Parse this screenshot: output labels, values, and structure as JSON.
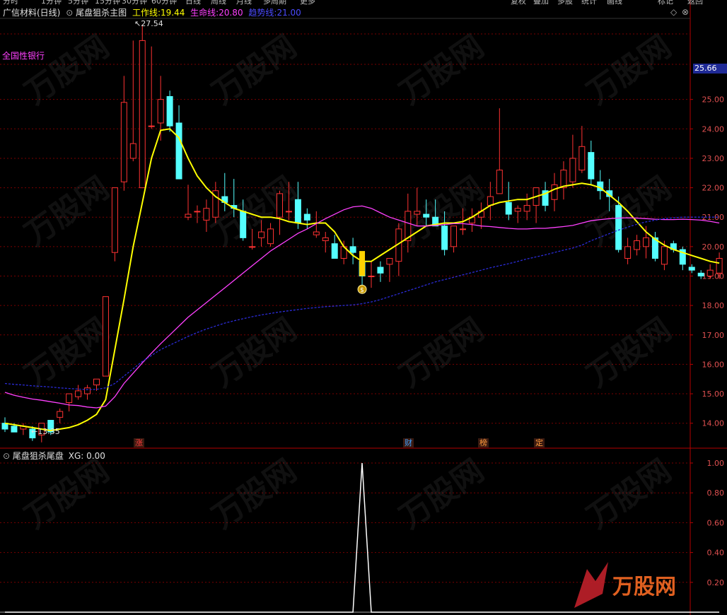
{
  "top_toolbar": [
    "分时",
    "1分钟",
    "5分钟",
    "15分钟",
    "30分钟",
    "60分钟",
    "日线",
    "周线",
    "月线",
    "多周期",
    "更多",
    "复权",
    "叠加",
    "多股",
    "统计",
    "画线",
    "标记",
    "返回"
  ],
  "header": {
    "stock": "广信材料(日线)",
    "indicator": "尾盘狙杀主图",
    "work_label": "工作线:",
    "work_value": "19.44",
    "life_label": "生命线:",
    "life_value": "20.80",
    "trend_label": "趋势线:",
    "trend_value": "21.00"
  },
  "sector_label": "全国性银行",
  "sub_header": {
    "indicator": "尾盘狙杀尾盘",
    "xg_label": "XG:",
    "xg_value": "0.00"
  },
  "annotations": {
    "high": "27.54",
    "low": "13.35",
    "current_price": "25.66"
  },
  "event_tags": [
    {
      "text": "涨",
      "index": 8
    },
    {
      "text": "财",
      "index": 25
    },
    {
      "text": "榜",
      "index": 30
    },
    {
      "text": "定",
      "index": 34
    }
  ],
  "colors": {
    "up": "#ff3232",
    "down": "#54ffff",
    "work": "#ffff00",
    "life": "#ff40ff",
    "trend": "#2b2bd6",
    "grid": "#7a0000",
    "axis": "#b40000",
    "bg": "#000000"
  },
  "chart_data": [
    {
      "type": "candlestick",
      "y_ticks": [
        "25.00",
        "24.00",
        "23.00",
        "22.00",
        "21.00",
        "20.00",
        "19.00",
        "18.00",
        "17.00",
        "16.00",
        "15.00",
        "14.00"
      ],
      "ylim": [
        13.2,
        27.85
      ],
      "ohlc": [
        [
          14.0,
          14.2,
          13.7,
          13.8
        ],
        [
          13.9,
          14.0,
          13.7,
          13.7
        ],
        [
          13.8,
          14.0,
          13.6,
          13.9
        ],
        [
          13.8,
          13.9,
          13.4,
          13.5
        ],
        [
          13.6,
          14.0,
          13.35,
          14.0
        ],
        [
          14.1,
          14.1,
          13.6,
          13.7
        ],
        [
          14.2,
          14.5,
          14.0,
          14.4
        ],
        [
          14.7,
          15.0,
          14.4,
          15.0
        ],
        [
          14.9,
          15.3,
          14.8,
          15.1
        ],
        [
          15.0,
          15.3,
          14.8,
          15.2
        ],
        [
          15.3,
          15.5,
          15.1,
          15.5
        ],
        [
          15.6,
          18.3,
          15.6,
          18.3
        ],
        [
          19.8,
          22.0,
          19.5,
          22.0
        ],
        [
          22.2,
          25.8,
          21.9,
          24.9
        ],
        [
          23.0,
          27.0,
          22.9,
          23.5
        ],
        [
          22.0,
          27.54,
          22.0,
          27.0
        ],
        [
          24.1,
          26.8,
          24.0,
          24.1
        ],
        [
          24.2,
          25.8,
          23.6,
          25.0
        ],
        [
          25.1,
          25.3,
          23.9,
          24.1
        ],
        [
          24.2,
          24.8,
          22.3,
          22.3
        ],
        [
          21.0,
          22.1,
          20.9,
          21.1
        ],
        [
          21.2,
          21.4,
          20.8,
          21.2
        ],
        [
          20.9,
          21.6,
          20.5,
          21.3
        ],
        [
          21.0,
          22.2,
          20.8,
          21.9
        ],
        [
          21.7,
          22.5,
          21.2,
          21.5
        ],
        [
          21.4,
          22.3,
          21.0,
          21.3
        ],
        [
          21.2,
          21.6,
          20.2,
          20.3
        ],
        [
          20.0,
          20.6,
          19.9,
          20.0
        ],
        [
          20.3,
          20.9,
          20.0,
          20.5
        ],
        [
          20.1,
          20.8,
          20.0,
          20.6
        ],
        [
          21.0,
          21.9,
          20.4,
          21.8
        ],
        [
          21.2,
          22.2,
          20.9,
          21.2
        ],
        [
          21.6,
          22.2,
          20.6,
          20.8
        ],
        [
          21.1,
          21.3,
          20.6,
          20.9
        ],
        [
          20.4,
          21.2,
          20.3,
          20.5
        ],
        [
          20.2,
          20.5,
          19.8,
          20.3
        ],
        [
          20.1,
          20.4,
          19.6,
          19.6
        ],
        [
          19.6,
          20.2,
          19.4,
          20.0
        ],
        [
          20.0,
          20.3,
          19.4,
          19.8
        ],
        [
          19.5,
          19.6,
          18.6,
          19.0
        ],
        [
          19.0,
          19.5,
          18.6,
          19.0
        ],
        [
          19.3,
          19.5,
          18.8,
          19.1
        ],
        [
          19.4,
          19.6,
          18.8,
          19.6
        ],
        [
          19.5,
          20.8,
          19.0,
          20.6
        ],
        [
          20.2,
          21.8,
          19.8,
          21.2
        ],
        [
          21.1,
          22.0,
          20.7,
          21.2
        ],
        [
          21.1,
          21.6,
          20.7,
          21.0
        ],
        [
          21.0,
          21.6,
          20.7,
          20.7
        ],
        [
          20.7,
          21.2,
          19.7,
          19.9
        ],
        [
          20.0,
          20.7,
          19.8,
          20.7
        ],
        [
          20.6,
          21.3,
          20.4,
          20.6
        ],
        [
          20.8,
          21.3,
          20.5,
          21.0
        ],
        [
          21.0,
          21.5,
          20.6,
          21.2
        ],
        [
          21.4,
          22.2,
          20.9,
          21.7
        ],
        [
          21.8,
          24.7,
          21.8,
          22.6
        ],
        [
          21.5,
          22.2,
          20.9,
          21.1
        ],
        [
          21.2,
          21.4,
          20.8,
          21.3
        ],
        [
          21.2,
          21.8,
          20.9,
          21.4
        ],
        [
          21.4,
          22.0,
          20.8,
          22.0
        ],
        [
          21.9,
          22.2,
          21.2,
          21.4
        ],
        [
          21.6,
          22.5,
          21.2,
          22.1
        ],
        [
          22.0,
          22.9,
          21.6,
          22.6
        ],
        [
          22.2,
          23.8,
          22.0,
          23.0
        ],
        [
          22.6,
          24.1,
          22.5,
          23.4
        ],
        [
          23.2,
          23.6,
          22.1,
          22.3
        ],
        [
          22.2,
          22.6,
          21.6,
          21.9
        ],
        [
          21.9,
          22.3,
          21.2,
          21.7
        ],
        [
          21.4,
          21.7,
          19.8,
          19.9
        ],
        [
          19.6,
          20.3,
          19.4,
          20.0
        ],
        [
          19.9,
          20.4,
          19.7,
          20.2
        ],
        [
          20.0,
          20.7,
          19.6,
          20.3
        ],
        [
          20.3,
          20.5,
          19.5,
          19.6
        ],
        [
          19.4,
          20.2,
          19.2,
          20.0
        ],
        [
          20.1,
          20.2,
          19.8,
          19.9
        ],
        [
          19.9,
          20.0,
          19.2,
          19.4
        ],
        [
          19.3,
          19.4,
          19.1,
          19.2
        ],
        [
          19.1,
          19.2,
          18.9,
          19.0
        ],
        [
          19.0,
          19.4,
          18.9,
          19.2
        ],
        [
          19.1,
          19.8,
          18.9,
          19.6
        ]
      ],
      "lines": [
        {
          "name": "工作线",
          "color": "#ffff00",
          "values": [
            14.0,
            13.95,
            13.9,
            13.85,
            13.8,
            13.75,
            13.8,
            13.85,
            13.95,
            14.1,
            14.3,
            14.8,
            16.5,
            18.2,
            20.0,
            21.5,
            23.0,
            23.95,
            24.0,
            23.7,
            23.0,
            22.4,
            22.0,
            21.7,
            21.5,
            21.3,
            21.2,
            21.1,
            21.0,
            21.0,
            20.95,
            20.85,
            20.8,
            20.75,
            20.8,
            20.8,
            20.5,
            20.0,
            19.7,
            19.5,
            19.5,
            19.7,
            19.9,
            20.1,
            20.3,
            20.5,
            20.7,
            20.75,
            20.8,
            20.8,
            20.85,
            21.0,
            21.2,
            21.4,
            21.5,
            21.55,
            21.6,
            21.6,
            21.7,
            21.8,
            21.95,
            22.05,
            22.1,
            22.15,
            22.1,
            22.0,
            21.75,
            21.5,
            21.2,
            20.85,
            20.5,
            20.25,
            20.05,
            19.9,
            19.8,
            19.7,
            19.6,
            19.5,
            19.44
          ]
        },
        {
          "name": "生命线",
          "color": "#ff40ff",
          "values": [
            15.05,
            14.95,
            14.88,
            14.82,
            14.78,
            14.73,
            14.68,
            14.62,
            14.6,
            14.55,
            14.52,
            14.58,
            14.9,
            15.35,
            15.7,
            16.05,
            16.38,
            16.7,
            17.0,
            17.3,
            17.6,
            17.85,
            18.1,
            18.35,
            18.6,
            18.85,
            19.1,
            19.35,
            19.6,
            19.85,
            20.05,
            20.25,
            20.45,
            20.6,
            20.78,
            20.95,
            21.1,
            21.25,
            21.35,
            21.38,
            21.3,
            21.15,
            21.0,
            20.9,
            20.8,
            20.7,
            20.7,
            20.72,
            20.75,
            20.78,
            20.78,
            20.75,
            20.7,
            20.68,
            20.65,
            20.62,
            20.6,
            20.6,
            20.62,
            20.62,
            20.65,
            20.68,
            20.72,
            20.8,
            20.88,
            20.92,
            20.95,
            20.97,
            20.98,
            20.97,
            20.95,
            20.93,
            20.92,
            20.92,
            20.93,
            20.92,
            20.9,
            20.86,
            20.8
          ]
        },
        {
          "name": "趋势线",
          "color": "#2b2bd6",
          "dashed": true,
          "values": [
            15.35,
            15.32,
            15.3,
            15.27,
            15.25,
            15.23,
            15.2,
            15.18,
            15.16,
            15.14,
            15.15,
            15.2,
            15.35,
            15.6,
            15.85,
            16.1,
            16.3,
            16.5,
            16.65,
            16.8,
            16.95,
            17.08,
            17.2,
            17.3,
            17.4,
            17.48,
            17.55,
            17.62,
            17.68,
            17.73,
            17.78,
            17.82,
            17.86,
            17.9,
            17.93,
            17.96,
            17.98,
            18.0,
            18.02,
            18.06,
            18.12,
            18.2,
            18.3,
            18.4,
            18.5,
            18.6,
            18.7,
            18.8,
            18.88,
            18.96,
            19.04,
            19.12,
            19.2,
            19.28,
            19.35,
            19.42,
            19.5,
            19.58,
            19.65,
            19.72,
            19.8,
            19.88,
            19.95,
            20.05,
            20.2,
            20.32,
            20.44,
            20.56,
            20.66,
            20.76,
            20.84,
            20.9,
            20.95,
            20.98,
            21.0,
            21.0,
            21.0,
            21.0,
            21.0
          ]
        }
      ],
      "markers": [
        {
          "index": 39,
          "label": "$"
        }
      ]
    },
    {
      "type": "line",
      "y_ticks": [
        "1.00",
        "0.80",
        "0.60",
        "0.40",
        "0.20"
      ],
      "ylim": [
        0,
        1.0
      ],
      "series": [
        {
          "name": "XG",
          "color": "#ffffff",
          "values": [
            0,
            0,
            0,
            0,
            0,
            0,
            0,
            0,
            0,
            0,
            0,
            0,
            0,
            0,
            0,
            0,
            0,
            0,
            0,
            0,
            0,
            0,
            0,
            0,
            0,
            0,
            0,
            0,
            0,
            0,
            0,
            0,
            0,
            0,
            0,
            0,
            0,
            0,
            0,
            1,
            0,
            0,
            0,
            0,
            0,
            0,
            0,
            0,
            0,
            0,
            0,
            0,
            0,
            0,
            0,
            0,
            0,
            0,
            0,
            0,
            0,
            0,
            0,
            0,
            0,
            0,
            0,
            0,
            0,
            0,
            0,
            0,
            0,
            0,
            0,
            0,
            0,
            0,
            0
          ]
        }
      ]
    }
  ]
}
